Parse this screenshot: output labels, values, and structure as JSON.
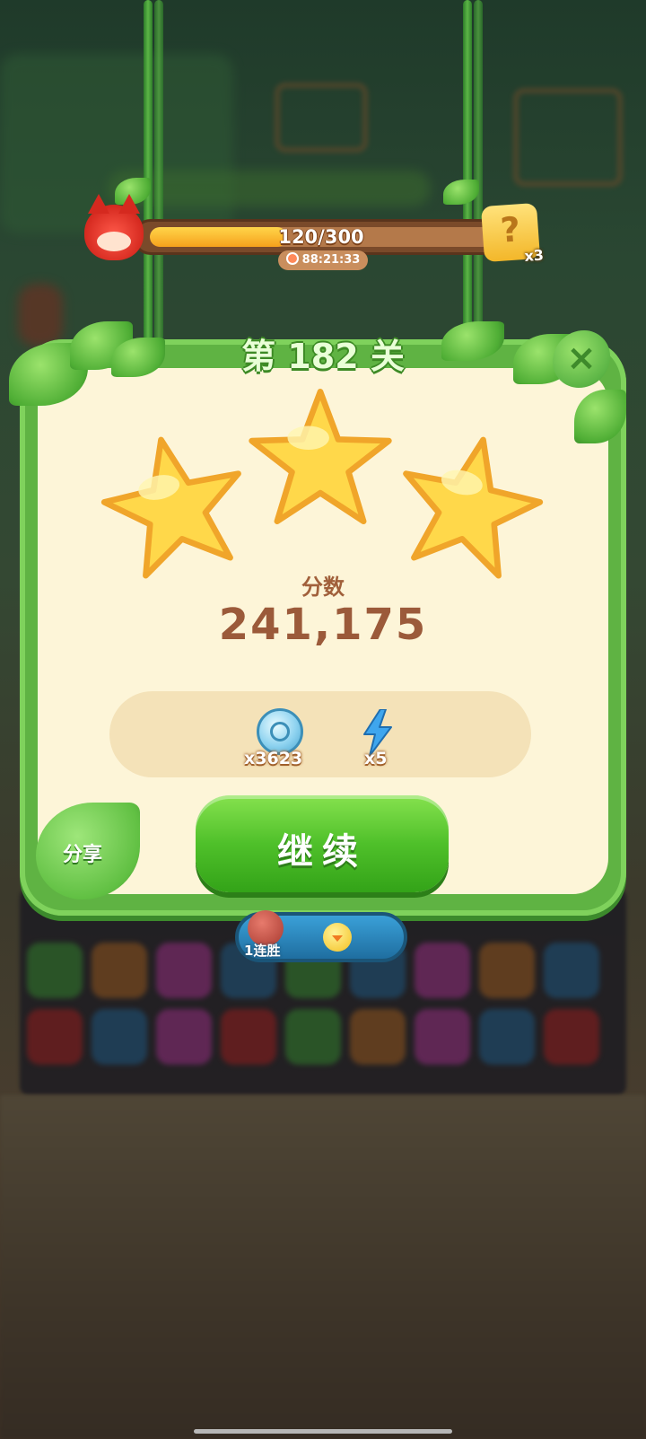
{
  "hud": {
    "progress_text": "120/300",
    "progress_fraction": 0.4,
    "timer": "88:21:33",
    "mystery_count": "x3",
    "mystery_symbol": "?"
  },
  "dialog": {
    "level_title": "第 182 关",
    "close_symbol": "×",
    "stars_earned": 3,
    "score_label": "分数",
    "score_value": "241,175",
    "rewards": [
      {
        "icon": "coin-icon",
        "count": "x3623"
      },
      {
        "icon": "lightning-icon",
        "count": "x5"
      }
    ],
    "continue_label": "继续",
    "share_label": "分享"
  },
  "streak": {
    "count": "1",
    "label": "连胜"
  },
  "colors": {
    "panel_green": "#5fb343",
    "panel_cream": "#fdf5d8",
    "score_brown": "#9b5a3a",
    "button_green": "#4fc02a",
    "star_yellow": "#ffd84a"
  }
}
